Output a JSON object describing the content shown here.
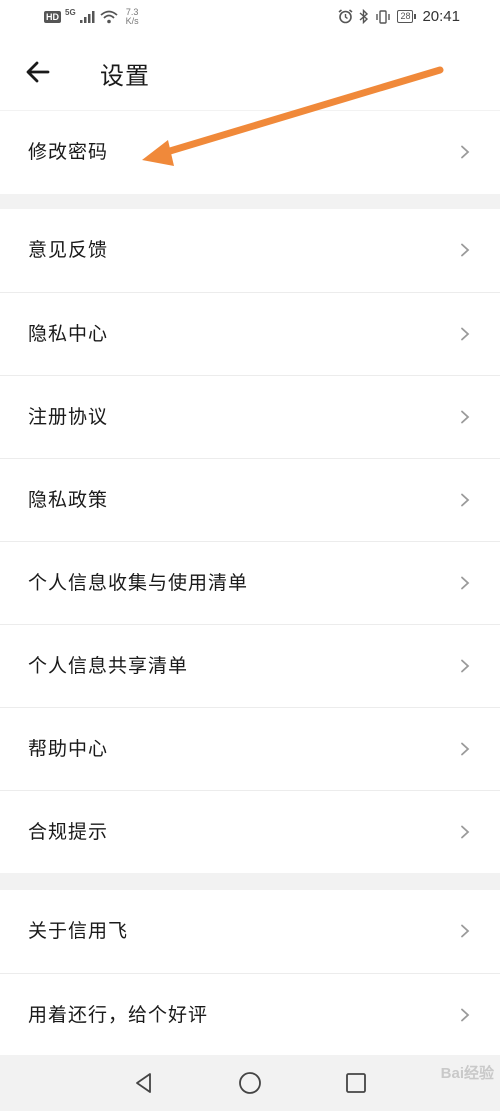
{
  "status_bar": {
    "hd": "HD",
    "network": "5G",
    "speed_value": "7.3",
    "speed_unit": "K/s",
    "battery": "28",
    "time": "20:41"
  },
  "header": {
    "title": "设置",
    "back_icon": "arrow-left-icon"
  },
  "groups": [
    {
      "items": [
        "修改密码"
      ]
    },
    {
      "items": [
        "意见反馈",
        "隐私中心",
        "注册协议",
        "隐私政策",
        "个人信息收集与使用清单",
        "个人信息共享清单",
        "帮助中心",
        "合规提示"
      ]
    },
    {
      "items": [
        "关于信用飞",
        "用着还行，给个好评"
      ]
    }
  ],
  "annotation": {
    "arrow_color": "#f0893a"
  },
  "nav_bar": {
    "icons": [
      "back-triangle-icon",
      "home-circle-icon",
      "recents-square-icon"
    ]
  },
  "watermark": {
    "text": "Bai经验"
  }
}
